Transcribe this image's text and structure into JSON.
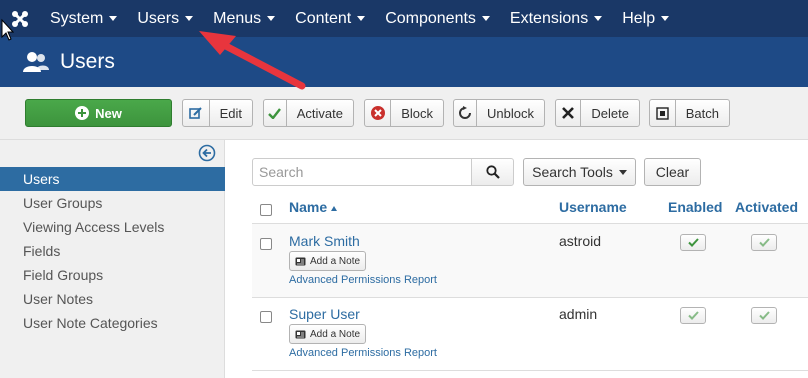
{
  "nav": {
    "logo_icon": "joomla-logo-icon",
    "items": [
      {
        "label": "System"
      },
      {
        "label": "Users"
      },
      {
        "label": "Menus"
      },
      {
        "label": "Content"
      },
      {
        "label": "Components"
      },
      {
        "label": "Extensions"
      },
      {
        "label": "Help"
      }
    ]
  },
  "header": {
    "title": "Users",
    "icon": "users-icon"
  },
  "toolbar": {
    "new_label": "New",
    "edit_label": "Edit",
    "activate_label": "Activate",
    "block_label": "Block",
    "unblock_label": "Unblock",
    "delete_label": "Delete",
    "batch_label": "Batch"
  },
  "sidebar": {
    "items": [
      {
        "label": "Users",
        "active": true
      },
      {
        "label": "User Groups"
      },
      {
        "label": "Viewing Access Levels"
      },
      {
        "label": "Fields"
      },
      {
        "label": "Field Groups"
      },
      {
        "label": "User Notes"
      },
      {
        "label": "User Note Categories"
      }
    ]
  },
  "filters": {
    "search_placeholder": "Search",
    "search_tools_label": "Search Tools",
    "clear_label": "Clear"
  },
  "table": {
    "columns": {
      "name": "Name",
      "username": "Username",
      "enabled": "Enabled",
      "activated": "Activated"
    },
    "rows": [
      {
        "name": "Mark Smith",
        "note_label": "Add a Note",
        "permissions_label": "Advanced Permissions Report",
        "username": "astroid",
        "enabled": true,
        "activated": true
      },
      {
        "name": "Super User",
        "note_label": "Add a Note",
        "permissions_label": "Advanced Permissions Report",
        "username": "admin",
        "enabled": true,
        "activated": true
      }
    ]
  },
  "colors": {
    "nav_bg": "#1a3867",
    "header_bg": "#1e4a86",
    "new_button": "#3d943d",
    "link": "#2d6ca2",
    "annotation_arrow": "#e8353d"
  }
}
